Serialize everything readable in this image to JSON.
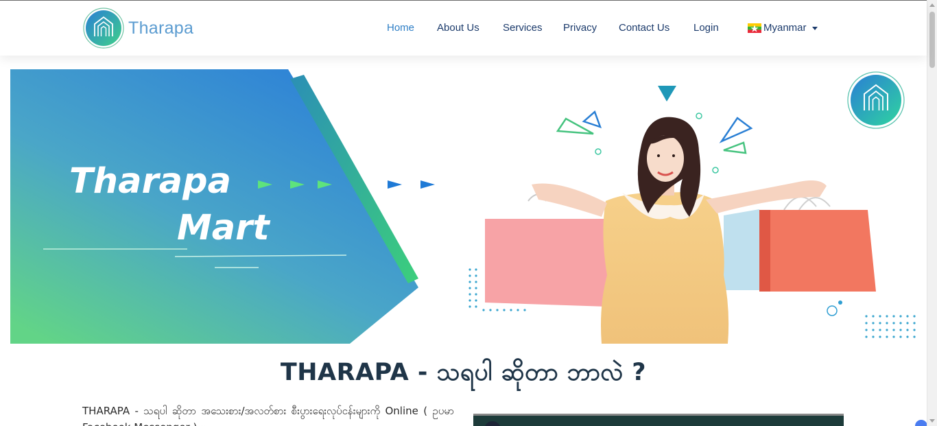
{
  "brand": {
    "name": "Tharapa"
  },
  "nav": {
    "items": [
      {
        "label": "Home",
        "active": true
      },
      {
        "label": "About Us",
        "active": false
      },
      {
        "label": "Services",
        "active": false
      },
      {
        "label": "Privacy",
        "active": false
      },
      {
        "label": "Contact Us",
        "active": false
      },
      {
        "label": "Login",
        "active": false
      }
    ],
    "language": {
      "label": "Myanmar",
      "flag": "myanmar-flag-icon"
    }
  },
  "hero": {
    "title_line1": "Tharapa",
    "title_line2": "Mart",
    "image": "woman-holding-shopping-bags"
  },
  "section": {
    "title": "THARAPA - သရပါ ဆိုတာ ဘာလဲ ?",
    "intro": "THARAPA - သရပါ ဆိုတာ အသေးစား/အလတ်စား စီးပွားရေးလုပ်ငန်းများကို Online ( ဥပမာ Facebook Messenger ) မှာ ..."
  },
  "colors": {
    "nav_text": "#1b3a6b",
    "nav_active": "#2f7fc6",
    "brand_text": "#5a9bd0",
    "accent_green": "#2fbf77",
    "accent_blue": "#2a7fd4"
  }
}
